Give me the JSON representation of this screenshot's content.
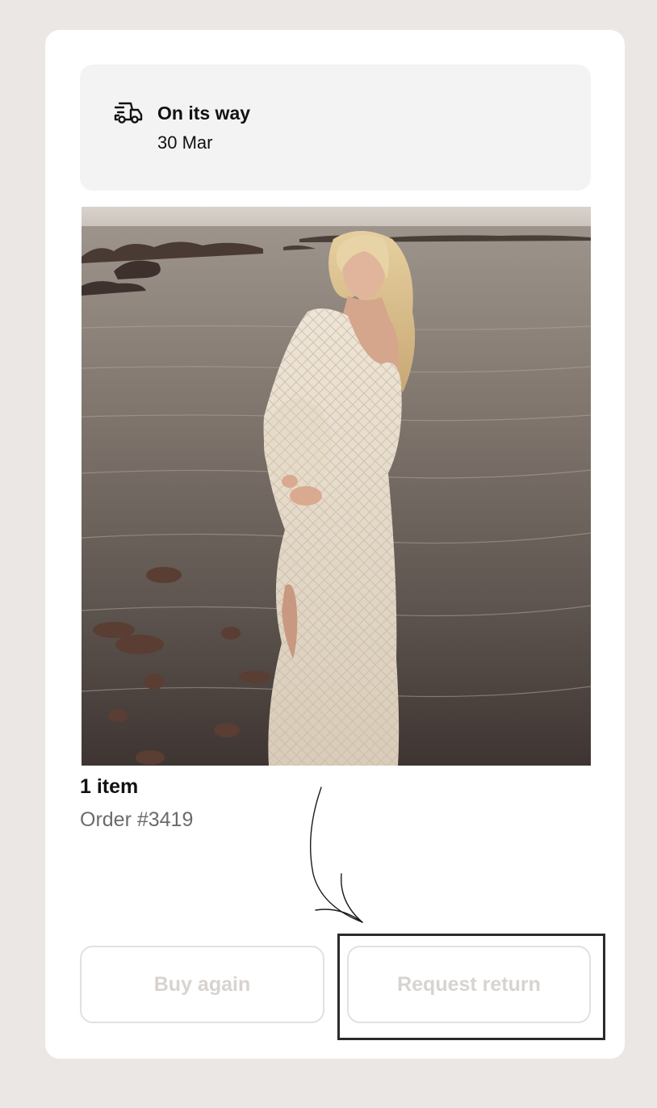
{
  "status": {
    "icon": "delivery-truck-icon",
    "title": "On its way",
    "date": "30 Mar"
  },
  "product_image": {
    "alt": ""
  },
  "order": {
    "item_count": "1 item",
    "order_number": "Order #3419"
  },
  "actions": {
    "buy_again_label": "Buy again",
    "request_return_label": "Request return"
  },
  "colors": {
    "background": "#ebe7e4",
    "card": "#ffffff",
    "status_box": "#f3f3f3",
    "button_text": "#d8d3cf",
    "highlight_border": "#2b2b2b"
  }
}
